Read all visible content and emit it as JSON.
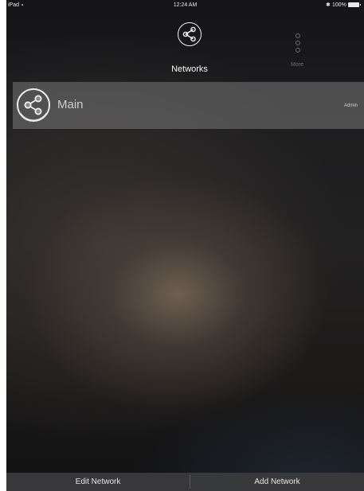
{
  "status_bar": {
    "carrier": "iPad",
    "time": "12:24 AM",
    "battery_text": "100%"
  },
  "nav": {
    "networks_label": "Networks",
    "more_label": "More",
    "networks_icon": "share-icon",
    "more_icon": "more-dots-icon"
  },
  "networks": [
    {
      "name": "Main",
      "role": "Admin",
      "icon": "share-icon"
    }
  ],
  "toolbar": {
    "edit_label": "Edit Network",
    "add_label": "Add Network"
  },
  "colors": {
    "row_bg": "#7a7a7a",
    "toolbar_bg": "#3c3c3e",
    "text_primary": "#f4f4f4",
    "text_dim": "#6f6f6f"
  }
}
